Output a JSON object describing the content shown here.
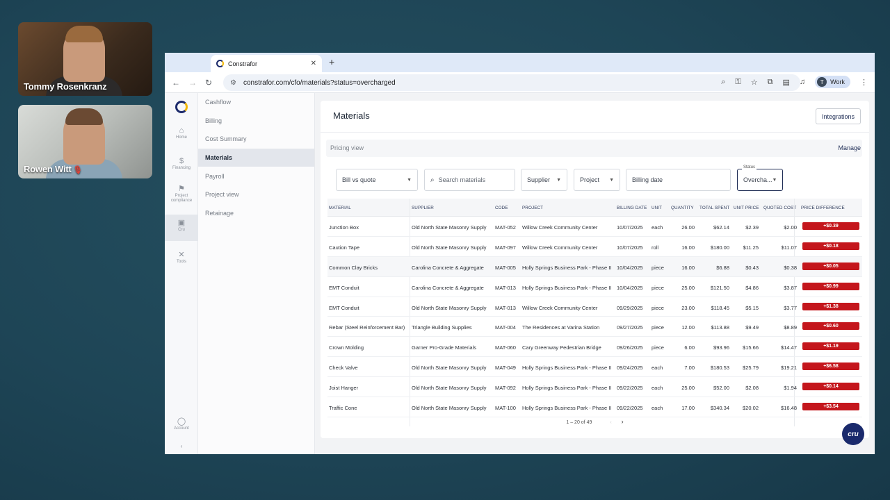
{
  "participants": [
    {
      "name": "Tommy Rosenkranz",
      "muted": false
    },
    {
      "name": "Rowen Witt",
      "muted": true
    }
  ],
  "browser": {
    "tab_title": "Constrafor",
    "url": "constrafor.com/cfo/materials?status=overcharged",
    "profile_initial": "T",
    "profile_label": "Work"
  },
  "rail": {
    "items": [
      {
        "label": "Home",
        "icon": "home-icon",
        "glyph": "⌂"
      },
      {
        "label": "Financing",
        "icon": "financing-icon",
        "glyph": "$"
      },
      {
        "label": "Project compliance",
        "icon": "compliance-icon",
        "glyph": "⚑"
      },
      {
        "label": "Cru",
        "icon": "cru-icon",
        "glyph": "▣"
      },
      {
        "label": "Tools",
        "icon": "tools-icon",
        "glyph": "✕"
      }
    ],
    "account_label": "Account",
    "collapse_glyph": "‹"
  },
  "subnav": {
    "items": [
      {
        "label": "Cashflow"
      },
      {
        "label": "Billing"
      },
      {
        "label": "Cost Summary"
      },
      {
        "label": "Materials",
        "active": true
      },
      {
        "label": "Payroll"
      },
      {
        "label": "Project view"
      },
      {
        "label": "Retainage"
      }
    ]
  },
  "page": {
    "title": "Materials",
    "integrations_label": "Integrations",
    "pricing_view_label": "Pricing view",
    "manage_label": "Manage"
  },
  "filters": {
    "view_select": "Bill vs quote",
    "search_placeholder": "Search materials",
    "supplier_label": "Supplier",
    "project_label": "Project",
    "billing_date_label": "Billing date",
    "status_label": "Status",
    "status_value": "Overcha..."
  },
  "table": {
    "columns": [
      "MATERIAL",
      "SUPPLIER",
      "CODE",
      "PROJECT",
      "BILLING DATE",
      "UNIT",
      "QUANTITY",
      "TOTAL SPENT",
      "UNIT PRICE",
      "QUOTED COST",
      "PRICE DIFFERENCE"
    ],
    "rows": [
      [
        "Junction Box",
        "Old North State Masonry Supply",
        "MAT-052",
        "Willow Creek Community Center",
        "10/07/2025",
        "each",
        "26.00",
        "$62.14",
        "$2.39",
        "$2.00",
        "+$0.39"
      ],
      [
        "Caution Tape",
        "Old North State Masonry Supply",
        "MAT-097",
        "Willow Creek Community Center",
        "10/07/2025",
        "roll",
        "16.00",
        "$180.00",
        "$11.25",
        "$11.07",
        "+$0.18"
      ],
      [
        "Common Clay Bricks",
        "Carolina Concrete & Aggregate",
        "MAT-005",
        "Holly Springs Business Park - Phase II",
        "10/04/2025",
        "piece",
        "16.00",
        "$6.88",
        "$0.43",
        "$0.38",
        "+$0.05"
      ],
      [
        "EMT Conduit",
        "Carolina Concrete & Aggregate",
        "MAT-013",
        "Holly Springs Business Park - Phase II",
        "10/04/2025",
        "piece",
        "25.00",
        "$121.50",
        "$4.86",
        "$3.87",
        "+$0.99"
      ],
      [
        "EMT Conduit",
        "Old North State Masonry Supply",
        "MAT-013",
        "Willow Creek Community Center",
        "09/29/2025",
        "piece",
        "23.00",
        "$118.45",
        "$5.15",
        "$3.77",
        "+$1.38"
      ],
      [
        "Rebar (Steel Reinforcement Bar)",
        "Triangle Building Supplies",
        "MAT-004",
        "The Residences at Varina Station",
        "09/27/2025",
        "piece",
        "12.00",
        "$113.88",
        "$9.49",
        "$8.89",
        "+$0.60"
      ],
      [
        "Crown Molding",
        "Garner Pro-Grade Materials",
        "MAT-060",
        "Cary Greenway Pedestrian Bridge",
        "09/26/2025",
        "piece",
        "6.00",
        "$93.96",
        "$15.66",
        "$14.47",
        "+$1.19"
      ],
      [
        "Check Valve",
        "Old North State Masonry Supply",
        "MAT-049",
        "Holly Springs Business Park - Phase II",
        "09/24/2025",
        "each",
        "7.00",
        "$180.53",
        "$25.79",
        "$19.21",
        "+$6.58"
      ],
      [
        "Joist Hanger",
        "Old North State Masonry Supply",
        "MAT-092",
        "Holly Springs Business Park - Phase II",
        "09/22/2025",
        "each",
        "25.00",
        "$52.00",
        "$2.08",
        "$1.94",
        "+$0.14"
      ],
      [
        "Traffic Cone",
        "Old North State Masonry Supply",
        "MAT-100",
        "Holly Springs Business Park - Phase II",
        "09/22/2025",
        "each",
        "17.00",
        "$340.34",
        "$20.02",
        "$16.48",
        "+$3.54"
      ]
    ],
    "highlighted_row": 2,
    "pagination": "1 – 20 of 49",
    "badge_color": "#c4161c"
  },
  "cru_button": "cru"
}
